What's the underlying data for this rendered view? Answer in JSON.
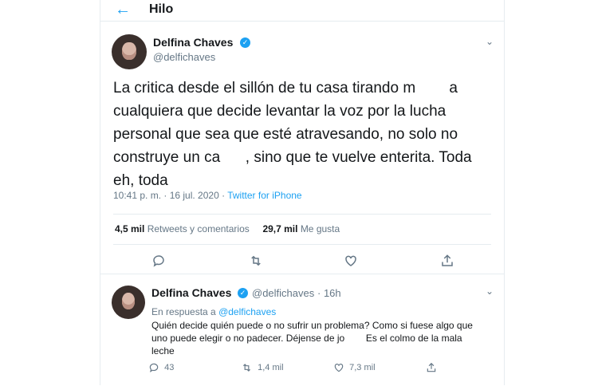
{
  "header": {
    "title": "Hilo"
  },
  "tweet": {
    "author_name": "Delfina Chaves",
    "author_handle": "@delfichaves",
    "text_lines": [
      "La critica desde el sillón de tu casa tirando m        a",
      "cualquiera que decide levantar la voz por la lucha",
      "personal que sea que esté atravesando, no solo no",
      "construye un ca      , sino que te vuelve enterita. Toda",
      "eh, toda"
    ],
    "time": "10:41 p. m. · 16 jul. 2020",
    "client": "Twitter for iPhone",
    "retweets_count": "4,5 mil",
    "retweets_label": "Retweets y comentarios",
    "likes_count": "29,7 mil",
    "likes_label": "Me gusta"
  },
  "reply": {
    "author_name": "Delfina Chaves",
    "author_handle": "@delfichaves",
    "age": "· 16h",
    "in_reply_prefix": "En respuesta a",
    "in_reply_handle": "@delfichaves",
    "text_lines": [
      "Quién decide quién puede o no sufrir un problema? Como si fuese algo que",
      "uno puede elegir o no padecer. Déjense de jo        Es el colmo de la mala",
      "leche"
    ],
    "replies_count": "43",
    "retweets_count": "1,4 mil",
    "likes_count": "7,3 mil"
  },
  "icons": [
    "back-arrow-icon",
    "verified-badge-icon",
    "chevron-down-icon",
    "reply-icon",
    "retweet-icon",
    "like-icon",
    "share-icon"
  ],
  "colors": {
    "accent": "#1da1f2",
    "text": "#14171a",
    "muted": "#657786",
    "border": "#e6ecf0"
  }
}
